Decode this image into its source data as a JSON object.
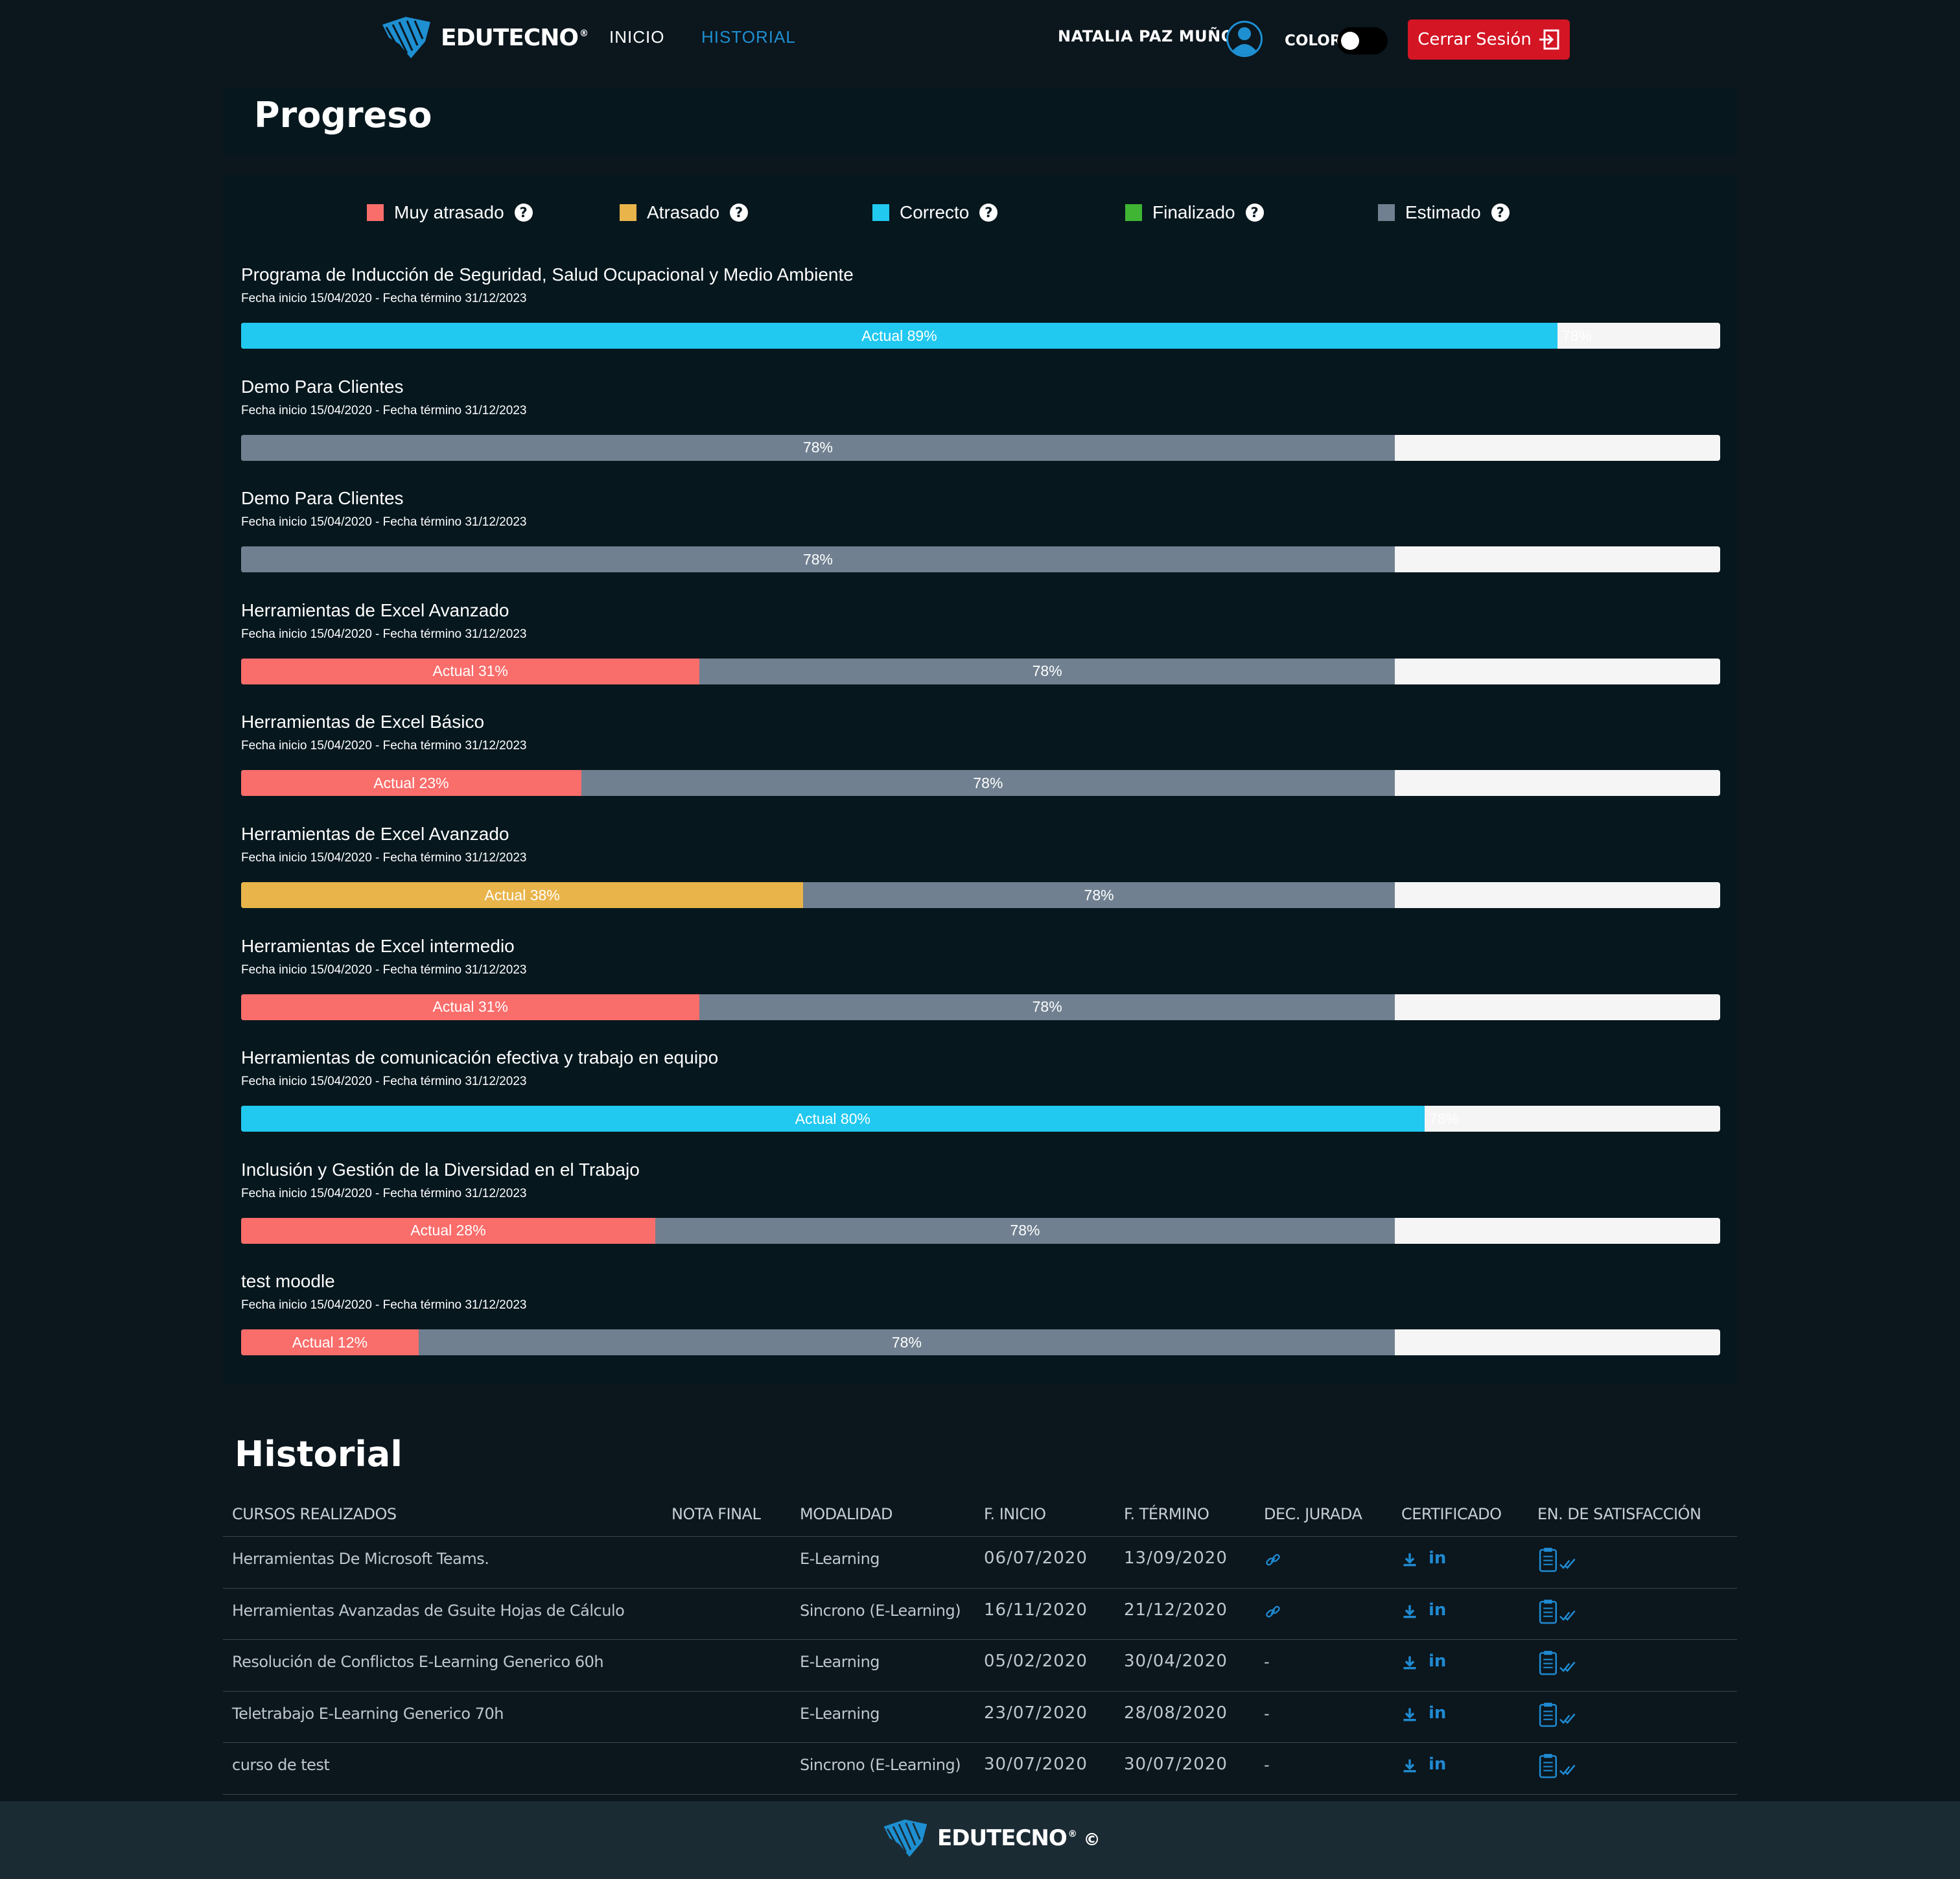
{
  "brand": {
    "name": "EDUTECNO",
    "mark": "®",
    "accent": "#1e8fd1"
  },
  "nav": {
    "home": "INICIO",
    "history": "HISTORIAL"
  },
  "user": {
    "name": "NATALIA PAZ MUÑOZ"
  },
  "color_toggle": {
    "label": "COLOR",
    "on": false
  },
  "logout": {
    "label": "Cerrar Sesión"
  },
  "progress": {
    "title": "Progreso",
    "legend": [
      {
        "label": "Muy atrasado",
        "color": "#f96d6b"
      },
      {
        "label": "Atrasado",
        "color": "#e9b44a"
      },
      {
        "label": "Correcto",
        "color": "#21c8f0"
      },
      {
        "label": "Finalizado",
        "color": "#3fb533"
      },
      {
        "label": "Estimado",
        "color": "#708090"
      }
    ],
    "courses": [
      {
        "title": "Programa de Inducción de Seguridad, Salud Ocupacional y Medio Ambiente",
        "dates": "Fecha inicio 15/04/2020 - Fecha término 31/12/2023",
        "actual": 89,
        "actual_label": "Actual 89%",
        "estimated": 78,
        "est_label": "78%",
        "status": "Correcto"
      },
      {
        "title": "Demo Para Clientes",
        "dates": "Fecha inicio 15/04/2020 - Fecha término 31/12/2023",
        "actual": null,
        "actual_label": "",
        "estimated": 78,
        "est_label": "78%",
        "status": "Estimado"
      },
      {
        "title": "Demo Para Clientes",
        "dates": "Fecha inicio 15/04/2020 - Fecha término 31/12/2023",
        "actual": null,
        "actual_label": "",
        "estimated": 78,
        "est_label": "78%",
        "status": "Estimado"
      },
      {
        "title": "Herramientas de Excel Avanzado",
        "dates": "Fecha inicio 15/04/2020 - Fecha término 31/12/2023",
        "actual": 31,
        "actual_label": "Actual 31%",
        "estimated": 78,
        "est_label": "78%",
        "status": "Muy atrasado"
      },
      {
        "title": "Herramientas de Excel Básico",
        "dates": "Fecha inicio 15/04/2020 - Fecha término 31/12/2023",
        "actual": 23,
        "actual_label": "Actual 23%",
        "estimated": 78,
        "est_label": "78%",
        "status": "Muy atrasado"
      },
      {
        "title": "Herramientas de Excel Avanzado",
        "dates": "Fecha inicio 15/04/2020 - Fecha término 31/12/2023",
        "actual": 38,
        "actual_label": "Actual 38%",
        "estimated": 78,
        "est_label": "78%",
        "status": "Atrasado"
      },
      {
        "title": "Herramientas de Excel intermedio",
        "dates": "Fecha inicio 15/04/2020 - Fecha término 31/12/2023",
        "actual": 31,
        "actual_label": "Actual 31%",
        "estimated": 78,
        "est_label": "78%",
        "status": "Muy atrasado"
      },
      {
        "title": "Herramientas de comunicación efectiva y trabajo en equipo",
        "dates": "Fecha inicio 15/04/2020 - Fecha término 31/12/2023",
        "actual": 80,
        "actual_label": "Actual 80%",
        "estimated": 78,
        "est_label": "78%",
        "status": "Correcto"
      },
      {
        "title": "Inclusión y Gestión de la Diversidad en el Trabajo",
        "dates": "Fecha inicio 15/04/2020 - Fecha término 31/12/2023",
        "actual": 28,
        "actual_label": "Actual 28%",
        "estimated": 78,
        "est_label": "78%",
        "status": "Muy atrasado"
      },
      {
        "title": "test moodle",
        "dates": "Fecha inicio 15/04/2020 - Fecha término 31/12/2023",
        "actual": 12,
        "actual_label": "Actual 12%",
        "estimated": 78,
        "est_label": "78%",
        "status": "Muy atrasado"
      }
    ]
  },
  "history": {
    "title": "Historial",
    "columns": [
      "CURSOS REALIZADOS",
      "NOTA FINAL",
      "MODALIDAD",
      "F. INICIO",
      "F. TÉRMINO",
      "DEC. JURADA",
      "CERTIFICADO",
      "EN. DE SATISFACCIÓN"
    ],
    "rows": [
      {
        "course": "Herramientas De Microsoft Teams.",
        "grade": "",
        "mode": "E-Learning",
        "start": "06/07/2020",
        "end": "13/09/2020",
        "declaration": "link",
        "declaration_text": ""
      },
      {
        "course": "Herramientas Avanzadas de Gsuite Hojas de Cálculo",
        "grade": "",
        "mode": "Sincrono (E-Learning)",
        "start": "16/11/2020",
        "end": "21/12/2020",
        "declaration": "link",
        "declaration_text": ""
      },
      {
        "course": "Resolución de Conflictos E-Learning Generico 60h",
        "grade": "",
        "mode": "E-Learning",
        "start": "05/02/2020",
        "end": "30/04/2020",
        "declaration": "none",
        "declaration_text": "-"
      },
      {
        "course": "Teletrabajo E-Learning Generico 70h",
        "grade": "",
        "mode": "E-Learning",
        "start": "23/07/2020",
        "end": "28/08/2020",
        "declaration": "none",
        "declaration_text": "-"
      },
      {
        "course": "curso de test",
        "grade": "",
        "mode": "Sincrono (E-Learning)",
        "start": "30/07/2020",
        "end": "30/07/2020",
        "declaration": "none",
        "declaration_text": "-"
      }
    ],
    "linkedin_text": "in"
  },
  "footer": {
    "brand": "EDUTECNO",
    "mark": "®",
    "copyright": "©"
  },
  "help_glyph": "?"
}
